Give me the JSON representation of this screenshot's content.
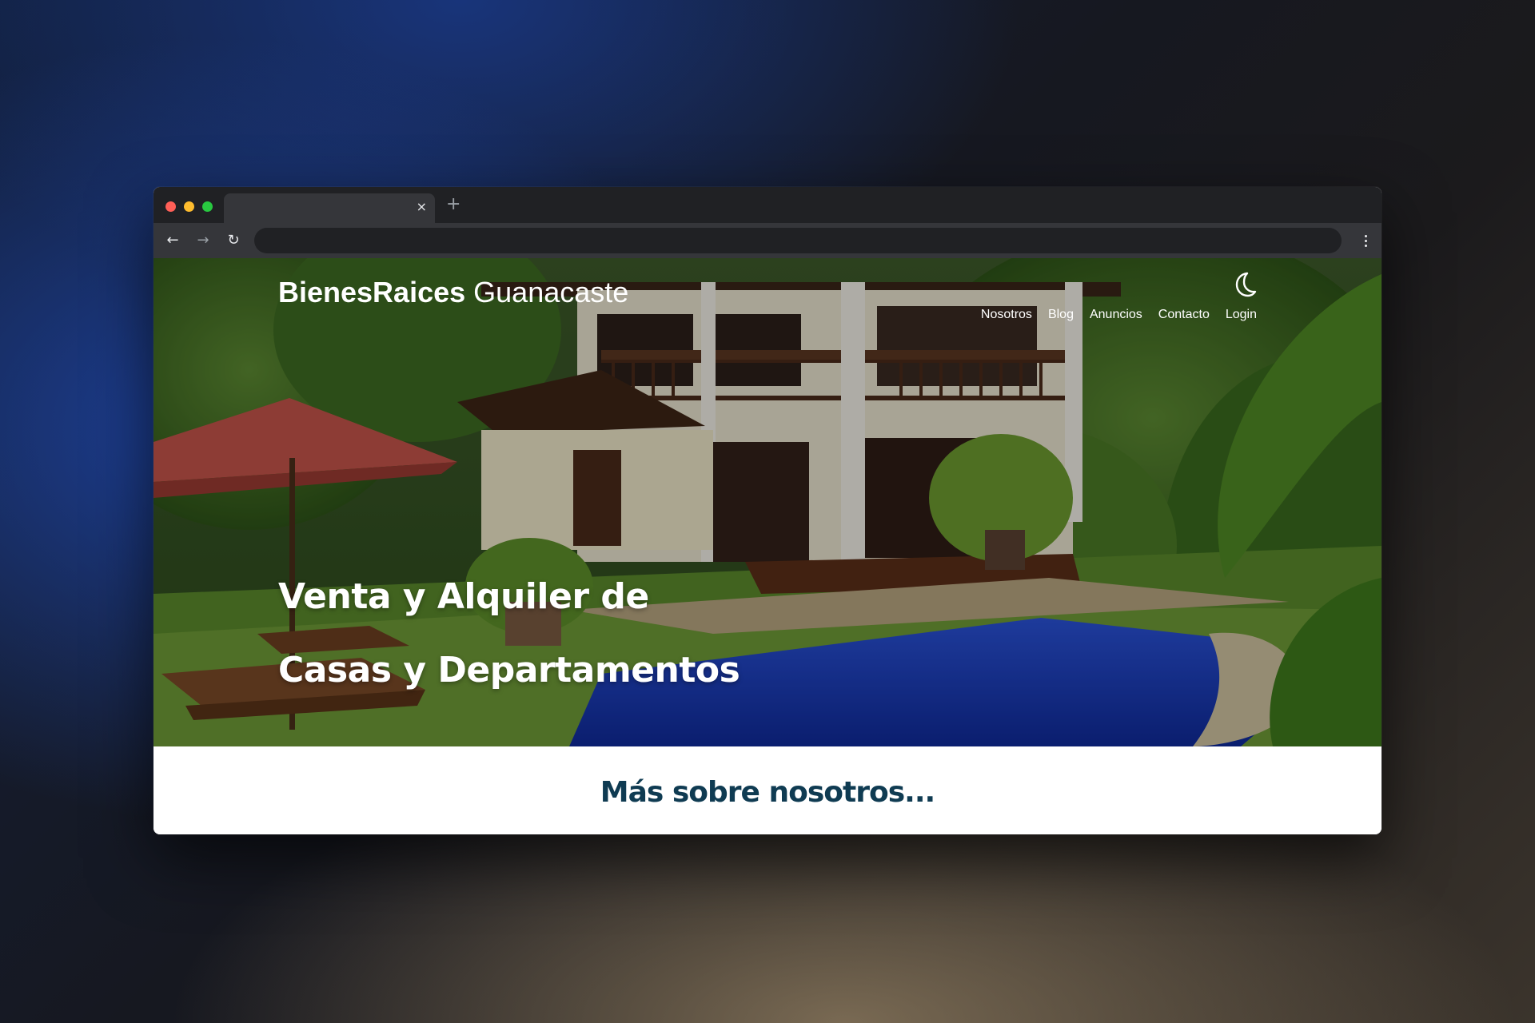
{
  "browser": {
    "tab_close": "×",
    "new_tab": "+",
    "back": "←",
    "forward": "→",
    "reload": "↻",
    "address": ""
  },
  "site": {
    "brand_bold": "BienesRaices",
    "brand_light": "Guanacaste",
    "nav": [
      "Nosotros",
      "Blog",
      "Anuncios",
      "Contacto",
      "Login"
    ],
    "hero_line1": "Venta y Alquiler de",
    "hero_line2": "Casas y Departamentos",
    "about_heading": "Más sobre nosotros..."
  },
  "colors": {
    "heading": "#0f3b52",
    "pool": "#1a3fc0",
    "umbrella": "#c4544a"
  },
  "icons": {
    "theme_toggle": "moon-icon"
  }
}
